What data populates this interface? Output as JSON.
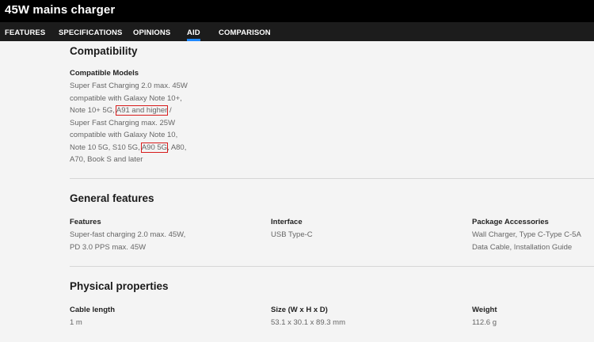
{
  "header": {
    "title": "45W mains charger"
  },
  "nav": {
    "items": [
      {
        "label": "FEATURES"
      },
      {
        "label": "SPECIFICATIONS"
      },
      {
        "label": "OPINIONS"
      },
      {
        "label": "AID"
      },
      {
        "label": "COMPARISON"
      }
    ],
    "active": "AID"
  },
  "compatibility": {
    "title": "Compatibility",
    "label": "Compatible Models",
    "text_parts": [
      "Super Fast Charging 2.0 max. 45W compatible with Galaxy Note 10+, Note 10+ 5G, ",
      "A91 and higher",
      " / Super Fast Charging max. 25W compatible with Galaxy Note 10, Note 10 5G, S10 5G, ",
      "A90 5G",
      ", A80, A70, Book S and later"
    ]
  },
  "general": {
    "title": "General features",
    "features_label": "Features",
    "features_value": "Super-fast charging 2.0 max. 45W, PD 3.0 PPS max. 45W",
    "interface_label": "Interface",
    "interface_value": "USB Type-C",
    "package_label": "Package Accessories",
    "package_value": "Wall Charger, Type C-Type C-5A Data Cable, Installation Guide"
  },
  "physical": {
    "title": "Physical properties",
    "cable_label": "Cable length",
    "cable_value": "1 m",
    "size_label": "Size (W x H x D)",
    "size_value": "53.1 x 30.1 x 89.3 mm",
    "weight_label": "Weight",
    "weight_value": "112.6 g"
  }
}
